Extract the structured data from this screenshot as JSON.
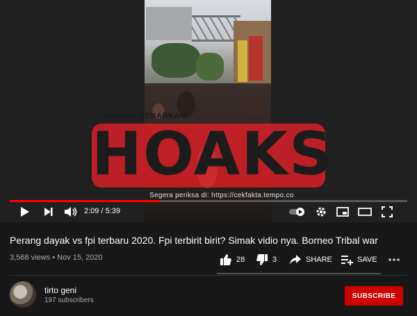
{
  "player": {
    "watermark_top": "JANGAN SEBARKAN",
    "watermark_main": "HOAKS",
    "watermark_sub": "Segera periksa di: https://cekfakta.tempo.co",
    "time": "2:09 / 5:39",
    "progress": 0.379,
    "colors": {
      "progress": "#ff0000",
      "hoaks": "#d61f26"
    },
    "icons": [
      "play-icon",
      "next-icon",
      "volume-icon",
      "autoplay-toggle-icon",
      "settings-icon",
      "miniplayer-icon",
      "theater-icon",
      "fullscreen-icon"
    ]
  },
  "video": {
    "title": "Perang dayak vs fpi terbaru 2020. Fpi terbirit birit? Simak vidio nya. Borneo Tribal war",
    "views": "3,568 views",
    "date": "Nov 15, 2020",
    "likes": "28",
    "dislikes": "3",
    "share_label": "SHARE",
    "save_label": "SAVE"
  },
  "channel": {
    "name": "tirto geni",
    "subscribers": "197 subscribers",
    "subscribe_label": "SUBSCRIBE",
    "subscribe_color": "#cc0000"
  }
}
